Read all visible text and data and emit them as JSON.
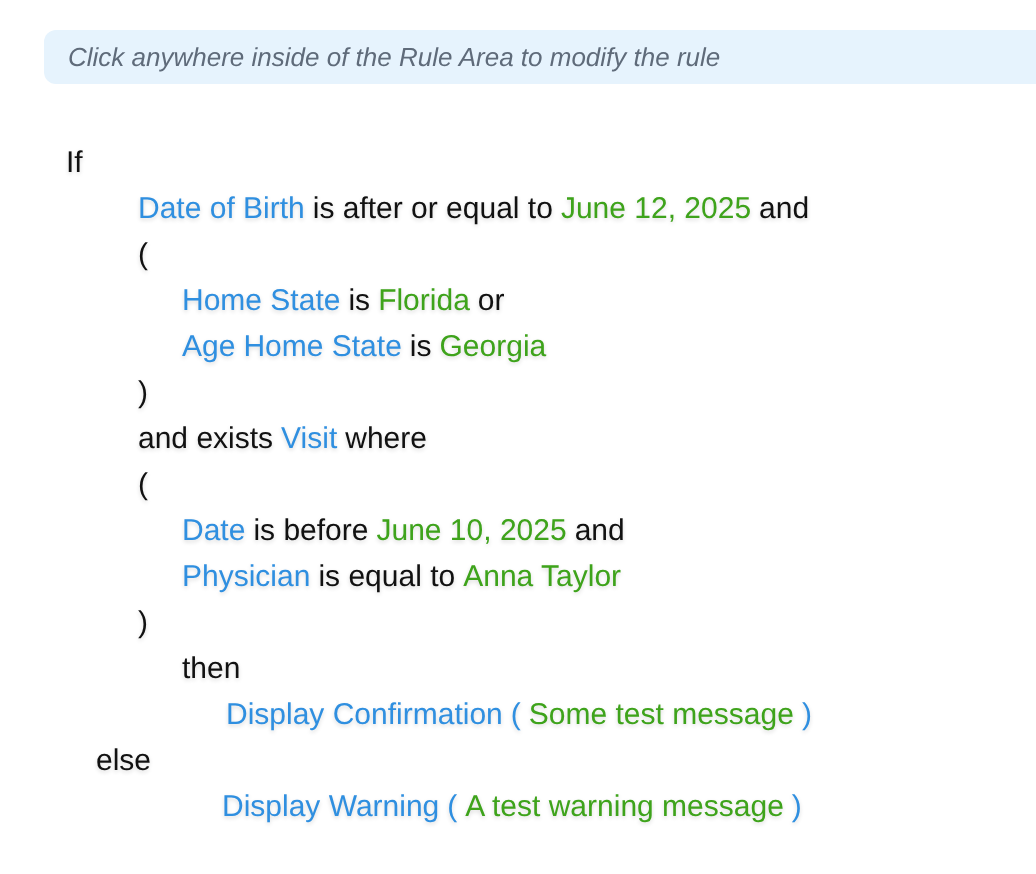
{
  "hint": "Click anywhere inside of the Rule Area to modify the rule",
  "rule": [
    {
      "tokens": [
        {
          "kind": "keyword",
          "text": "If"
        }
      ],
      "children": [
        {
          "tokens": [
            {
              "kind": "field",
              "text": "Date of Birth"
            },
            {
              "kind": "keyword",
              "text": "is after or equal to"
            },
            {
              "kind": "value",
              "text": "June 12, 2025"
            },
            {
              "kind": "keyword",
              "text": "and"
            }
          ]
        },
        {
          "tokens": [
            {
              "kind": "keyword",
              "text": "("
            }
          ],
          "children": [
            {
              "tokens": [
                {
                  "kind": "field",
                  "text": "Home State"
                },
                {
                  "kind": "keyword",
                  "text": "is"
                },
                {
                  "kind": "value",
                  "text": "Florida"
                },
                {
                  "kind": "keyword",
                  "text": "or"
                }
              ]
            },
            {
              "tokens": [
                {
                  "kind": "field",
                  "text": "Age"
                },
                {
                  "kind": "field",
                  "text": "Home State"
                },
                {
                  "kind": "keyword",
                  "text": "is"
                },
                {
                  "kind": "value",
                  "text": "Georgia"
                }
              ]
            }
          ]
        },
        {
          "tokens": [
            {
              "kind": "keyword",
              "text": ")"
            }
          ]
        },
        {
          "tokens": [
            {
              "kind": "keyword",
              "text": "and exists"
            },
            {
              "kind": "field",
              "text": "Visit"
            },
            {
              "kind": "keyword",
              "text": "where"
            }
          ]
        },
        {
          "tokens": [
            {
              "kind": "keyword",
              "text": "("
            }
          ],
          "children": [
            {
              "tokens": [
                {
                  "kind": "field",
                  "text": "Date"
                },
                {
                  "kind": "keyword",
                  "text": "is before"
                },
                {
                  "kind": "value",
                  "text": "June 10, 2025"
                },
                {
                  "kind": "keyword",
                  "text": "and"
                }
              ]
            },
            {
              "tokens": [
                {
                  "kind": "field",
                  "text": "Physician"
                },
                {
                  "kind": "keyword",
                  "text": "is equal to"
                },
                {
                  "kind": "value",
                  "text": "Anna Taylor"
                }
              ]
            }
          ]
        },
        {
          "tokens": [
            {
              "kind": "keyword",
              "text": ")"
            }
          ]
        },
        {
          "kind": "branch",
          "tokens": [
            {
              "kind": "keyword",
              "text": "then"
            }
          ],
          "children": [
            {
              "tokens": [
                {
                  "kind": "field",
                  "text": "Display Confirmation"
                },
                {
                  "kind": "field",
                  "text": "("
                },
                {
                  "kind": "value",
                  "text": "Some test message"
                },
                {
                  "kind": "field",
                  "text": ")"
                }
              ]
            }
          ]
        }
      ]
    },
    {
      "kind": "branch",
      "tokens": [
        {
          "kind": "keyword",
          "text": "else"
        }
      ],
      "children": [
        {
          "kind": "action",
          "tokens": [
            {
              "kind": "field",
              "text": "Display Warning"
            },
            {
              "kind": "field",
              "text": "("
            },
            {
              "kind": "value",
              "text": "A test warning message"
            },
            {
              "kind": "field",
              "text": ")"
            }
          ]
        }
      ]
    }
  ]
}
